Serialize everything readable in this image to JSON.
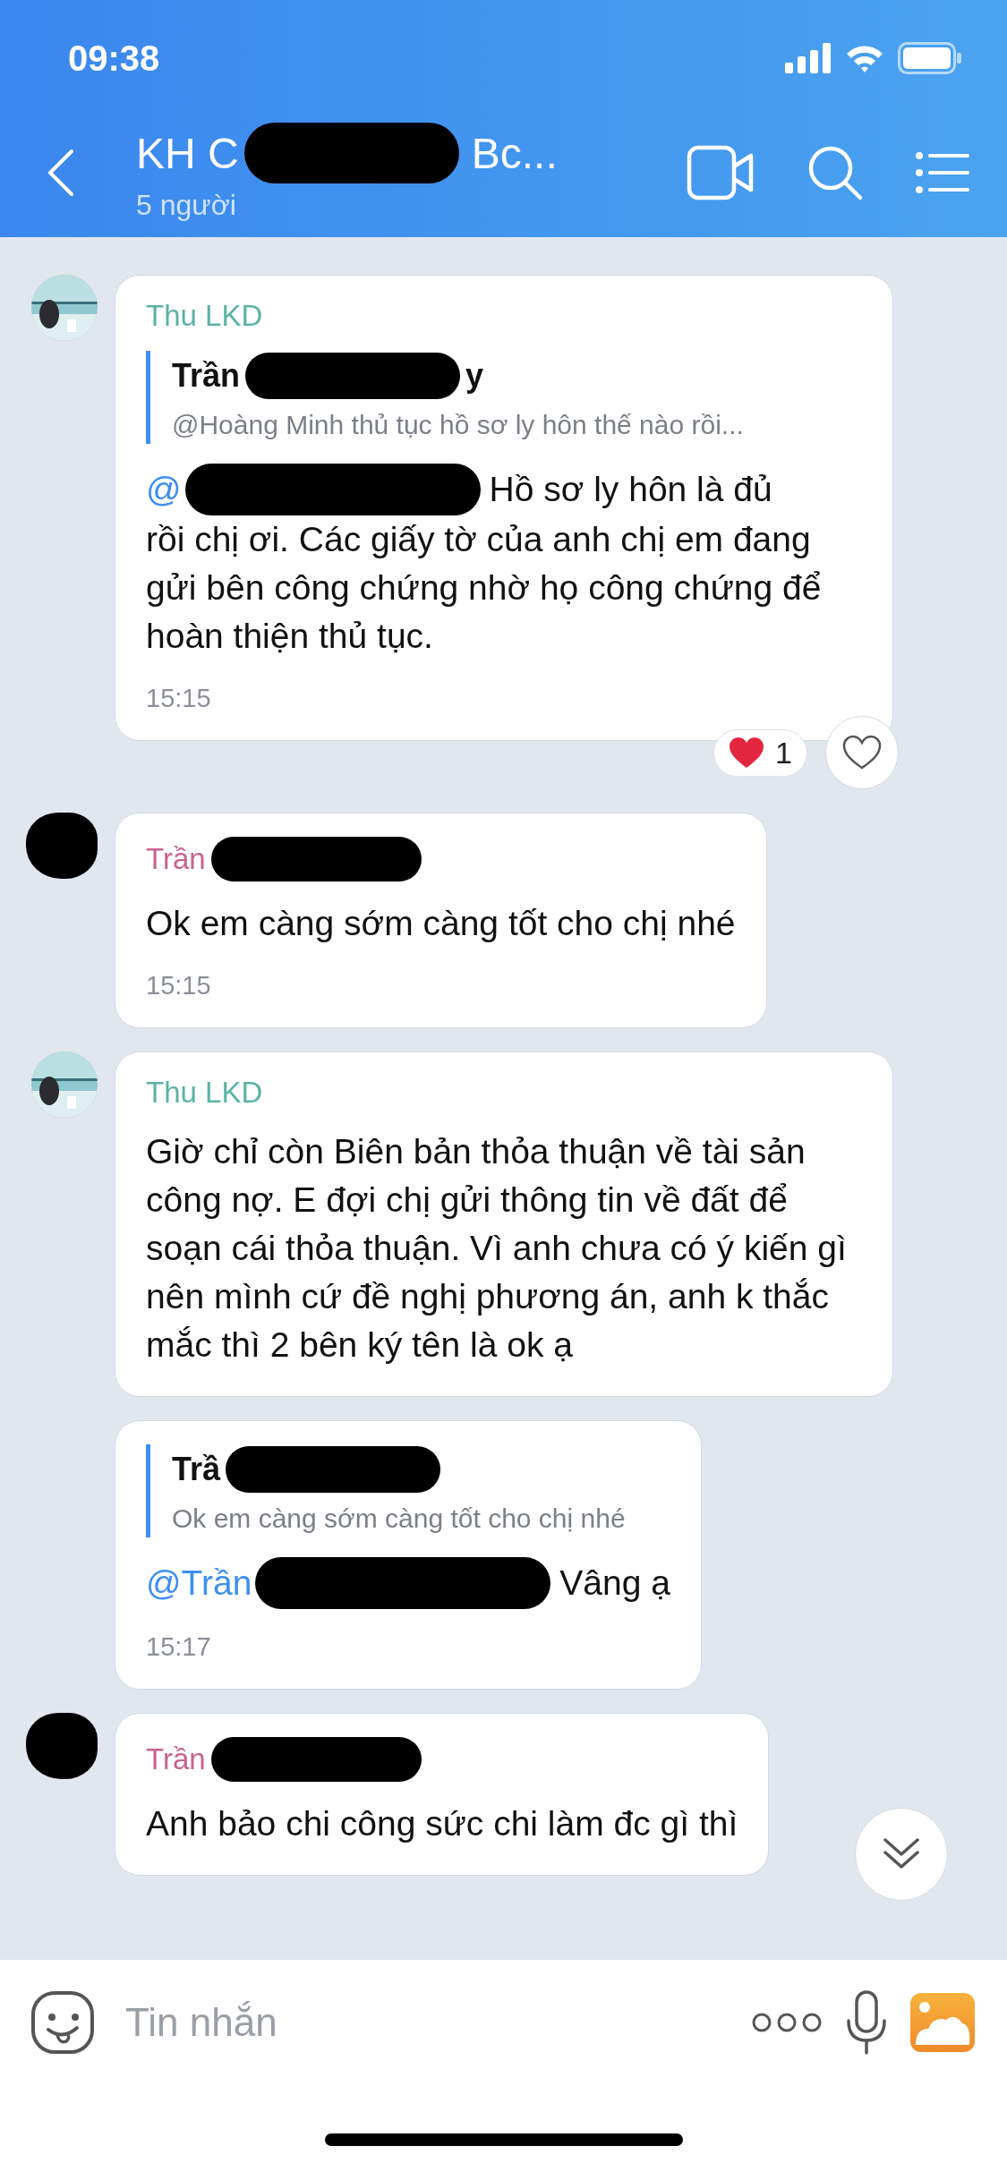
{
  "status_bar": {
    "time": "09:38"
  },
  "header": {
    "title_parts": [
      {
        "kind": "text",
        "text": "KH C"
      },
      {
        "kind": "redaction"
      },
      {
        "kind": "text",
        "text": "Bc..."
      }
    ],
    "subtitle": "5 người"
  },
  "messages": [
    {
      "avatar": {
        "kind": "picture"
      },
      "sender": {
        "color": "#5bb3a6",
        "parts": [
          {
            "kind": "text",
            "text": "Thu LKD"
          }
        ]
      },
      "quote": {
        "title_parts": [
          {
            "kind": "text",
            "text": "Trần"
          },
          {
            "kind": "redaction"
          },
          {
            "kind": "text",
            "text": "y"
          }
        ],
        "text": "@Hoàng Minh thủ tục hồ sơ ly hôn thế nào rồi..."
      },
      "body": [
        {
          "kind": "mention",
          "text": "@"
        },
        {
          "kind": "redaction"
        },
        {
          "kind": "text",
          "text": "Hồ sơ ly hôn là đủ"
        },
        {
          "kind": "text",
          "text": "rồi chị ơi. Các giấy tờ của anh chị em đang gửi bên công chứng nhờ họ công chứng để hoàn thiện thủ tục."
        }
      ],
      "time": "15:15",
      "reaction": {
        "count": "1"
      }
    },
    {
      "avatar": {
        "kind": "redacted"
      },
      "sender": {
        "color": "#c8628f",
        "parts": [
          {
            "kind": "text",
            "text": "Trần"
          },
          {
            "kind": "redaction"
          }
        ]
      },
      "body": [
        {
          "kind": "text",
          "text": "Ok em càng sớm càng tốt cho chị nhé"
        }
      ],
      "time": "15:15"
    },
    {
      "avatar": {
        "kind": "picture"
      },
      "sender": {
        "color": "#5bb3a6",
        "parts": [
          {
            "kind": "text",
            "text": "Thu LKD"
          }
        ]
      },
      "body": [
        {
          "kind": "text",
          "text": "Giờ chỉ còn Biên bản thỏa thuận về tài sản công nợ. E đợi chị gửi thông tin về đất để soạn cái thỏa thuận. Vì anh chưa có ý kiến gì nên mình cứ đề nghị phương án, anh k thắc mắc thì 2 bên ký tên là ok ạ"
        }
      ]
    },
    {
      "quote": {
        "title_parts": [
          {
            "kind": "text",
            "text": "Trầ"
          },
          {
            "kind": "redaction"
          }
        ],
        "text": "Ok em càng sớm càng tốt cho chị nhé"
      },
      "body": [
        {
          "kind": "mention",
          "text": "@Trần"
        },
        {
          "kind": "redaction"
        },
        {
          "kind": "text",
          "text": "Vâng ạ"
        }
      ],
      "time": "15:17"
    },
    {
      "avatar": {
        "kind": "redacted"
      },
      "sender": {
        "color": "#c8628f",
        "parts": [
          {
            "kind": "text",
            "text": "Trần"
          },
          {
            "kind": "redaction"
          }
        ]
      },
      "body": [
        {
          "kind": "text",
          "text": "Anh bảo chi công sức chi làm đc gì thì"
        }
      ]
    }
  ],
  "composer": {
    "placeholder": "Tin nhắn"
  }
}
